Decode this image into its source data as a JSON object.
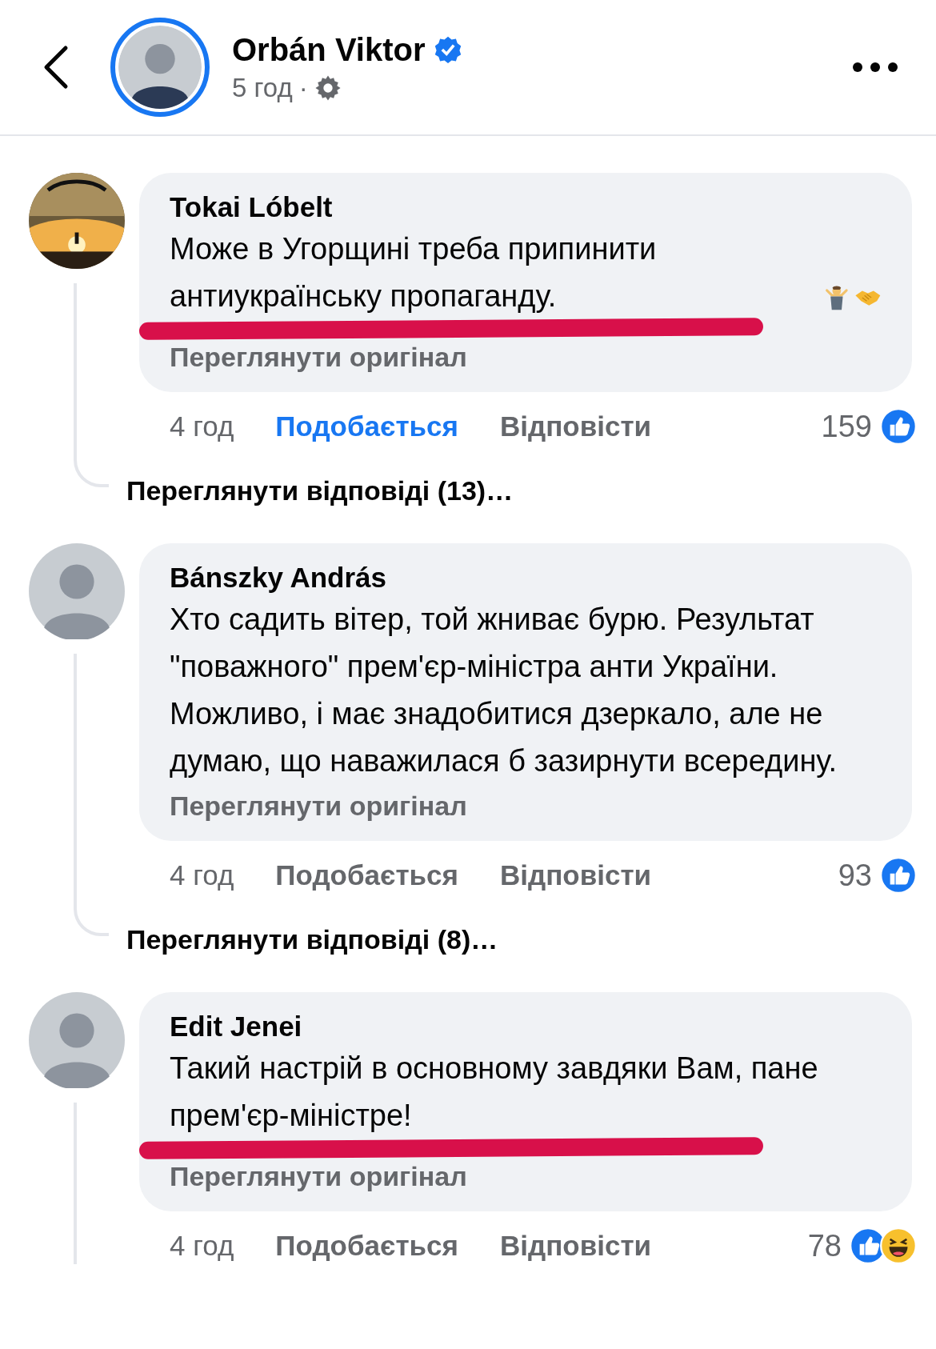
{
  "header": {
    "name": "Orbán Viktor",
    "verified": true,
    "time": "5 год",
    "separator": "·"
  },
  "comments": [
    {
      "author": "Tokai Lóbelt",
      "avatar": {
        "kind": "picture"
      },
      "text": "Може в Угорщині треба припинити антиукраїнську пропаганду.",
      "emoji": [
        {
          "kind": "shrug"
        },
        {
          "kind": "handshake"
        }
      ],
      "see_original": "Переглянути оригінал",
      "marked": true,
      "time": "4 год",
      "like": "Подобається",
      "liked": true,
      "reply": "Відповісти",
      "reaction_count": "159",
      "reactions": [
        {
          "kind": "like"
        }
      ],
      "view_replies": "Переглянути відповіді (13)…"
    },
    {
      "author": "Bánszky András",
      "avatar": {
        "kind": "person"
      },
      "text": "Хто садить вітер, той жниває бурю. Результат \"поважного\" прем'єр-міністра анти України. Можливо, і має знадобитися дзеркало, але не думаю, що наважилася б зазирнути всередину.",
      "see_original": "Переглянути оригінал",
      "marked": false,
      "time": "4 год",
      "like": "Подобається",
      "liked": false,
      "reply": "Відповісти",
      "reaction_count": "93",
      "reactions": [
        {
          "kind": "like"
        }
      ],
      "view_replies": "Переглянути відповіді (8)…"
    },
    {
      "author": "Edit Jenei",
      "avatar": {
        "kind": "person"
      },
      "text": "Такий настрій в основному завдяки Вам, пане прем'єр-міністре!",
      "see_original": "Переглянути оригінал",
      "marked": true,
      "time": "4 год",
      "like": "Подобається",
      "liked": false,
      "reply": "Відповісти",
      "reaction_count": "78",
      "reactions": [
        {
          "kind": "like"
        },
        {
          "kind": "haha"
        }
      ]
    }
  ]
}
